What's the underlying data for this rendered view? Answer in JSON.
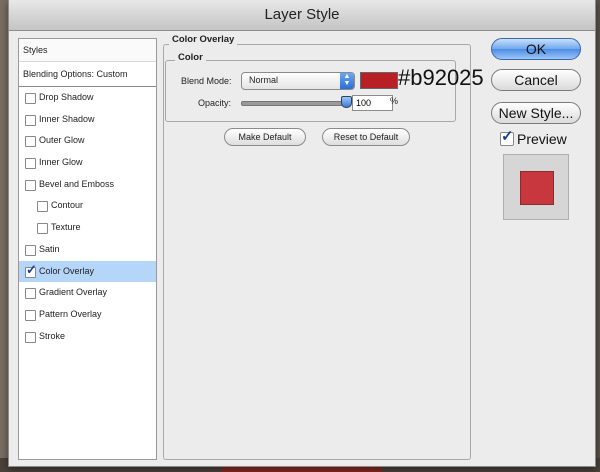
{
  "window": {
    "title": "Layer Style"
  },
  "styles_panel": {
    "header": "Styles",
    "blending_options": "Blending Options: Custom",
    "items": [
      {
        "label": "Drop Shadow",
        "checked": false,
        "sub": false,
        "selected": false
      },
      {
        "label": "Inner Shadow",
        "checked": false,
        "sub": false,
        "selected": false
      },
      {
        "label": "Outer Glow",
        "checked": false,
        "sub": false,
        "selected": false
      },
      {
        "label": "Inner Glow",
        "checked": false,
        "sub": false,
        "selected": false
      },
      {
        "label": "Bevel and Emboss",
        "checked": false,
        "sub": false,
        "selected": false
      },
      {
        "label": "Contour",
        "checked": false,
        "sub": true,
        "selected": false
      },
      {
        "label": "Texture",
        "checked": false,
        "sub": true,
        "selected": false
      },
      {
        "label": "Satin",
        "checked": false,
        "sub": false,
        "selected": false
      },
      {
        "label": "Color Overlay",
        "checked": true,
        "sub": false,
        "selected": true
      },
      {
        "label": "Gradient Overlay",
        "checked": false,
        "sub": false,
        "selected": false
      },
      {
        "label": "Pattern Overlay",
        "checked": false,
        "sub": false,
        "selected": false
      },
      {
        "label": "Stroke",
        "checked": false,
        "sub": false,
        "selected": false
      }
    ]
  },
  "color_overlay": {
    "section_title": "Color Overlay",
    "group_title": "Color",
    "blend_mode_label": "Blend Mode:",
    "blend_mode_value": "Normal",
    "color": "#b92025",
    "color_annotation": "#b92025",
    "opacity_label": "Opacity:",
    "opacity_value": "100",
    "opacity_unit": "%",
    "opacity_slider_level": 1.0,
    "make_default": "Make Default",
    "reset_to_default": "Reset to Default"
  },
  "buttons": {
    "ok": "OK",
    "cancel": "Cancel",
    "new_style": "New Style..."
  },
  "preview": {
    "label": "Preview",
    "checked": true,
    "swatch_color": "#c8373d"
  }
}
